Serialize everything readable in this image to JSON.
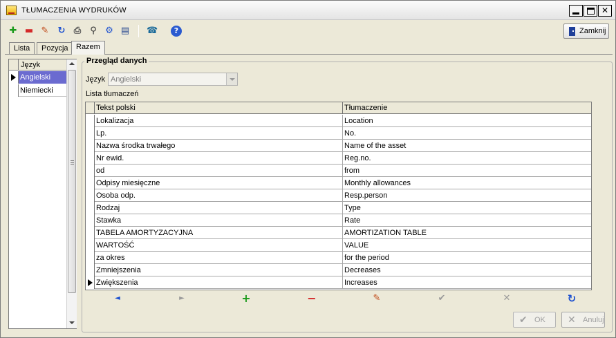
{
  "window": {
    "title": "TŁUMACZENIA WYDRUKÓW",
    "controls": {
      "minimize": "",
      "maximize": "",
      "close": "✕"
    }
  },
  "toolbar": {
    "icons": [
      "add-icon",
      "delete-icon",
      "edit-icon",
      "refresh-icon",
      "print-icon",
      "search-icon",
      "filter-icon",
      "columns-icon",
      "phone-icon",
      "help-icon"
    ],
    "close_label": "Zamknij"
  },
  "tabs": [
    {
      "label": "Lista"
    },
    {
      "label": "Pozycja"
    },
    {
      "label": "Razem"
    }
  ],
  "languages": {
    "header": "Język",
    "items": [
      "Angielski",
      "Niemiecki"
    ],
    "selected": "Angielski"
  },
  "preview": {
    "group_title": "Przegląd danych",
    "language_label": "Język",
    "language_value": "Angielski",
    "list_label": "Lista tłumaczeń"
  },
  "translations": {
    "columns": [
      "Tekst polski",
      "Tłumaczenie"
    ],
    "rows": [
      [
        "Lokalizacja",
        "Location"
      ],
      [
        "Lp.",
        "No."
      ],
      [
        "Nazwa środka trwałego",
        "Name of the asset"
      ],
      [
        "Nr ewid.",
        "Reg.no."
      ],
      [
        "od",
        "from"
      ],
      [
        "Odpisy miesięczne",
        "Monthly allowances"
      ],
      [
        "Osoba odp.",
        "Resp.person"
      ],
      [
        "Rodzaj",
        "Type"
      ],
      [
        "Stawka",
        "Rate"
      ],
      [
        "TABELA AMORTYZACYJNA",
        "AMORTIZATION TABLE"
      ],
      [
        "WARTOŚĆ",
        "VALUE"
      ],
      [
        "za okres",
        "for the period"
      ],
      [
        "Zmniejszenia",
        "Decreases"
      ],
      [
        "Zwiększenia",
        "Increases"
      ]
    ],
    "current_row": 13
  },
  "navigator": {
    "prior": "◄",
    "next": "►",
    "insert": "+",
    "delete": "−",
    "edit": "✎",
    "post": "✔",
    "cancel": "✕",
    "refresh": "↻"
  },
  "dialog": {
    "ok_label": "OK",
    "cancel_label": "Anuluj",
    "ok_glyph": "✔",
    "cancel_glyph": "✕"
  },
  "colors": {
    "selection": "#6b6bd0",
    "add_green": "#1a9a1a",
    "delete_red": "#d42a2a",
    "nav_blue": "#1a4fd0"
  }
}
